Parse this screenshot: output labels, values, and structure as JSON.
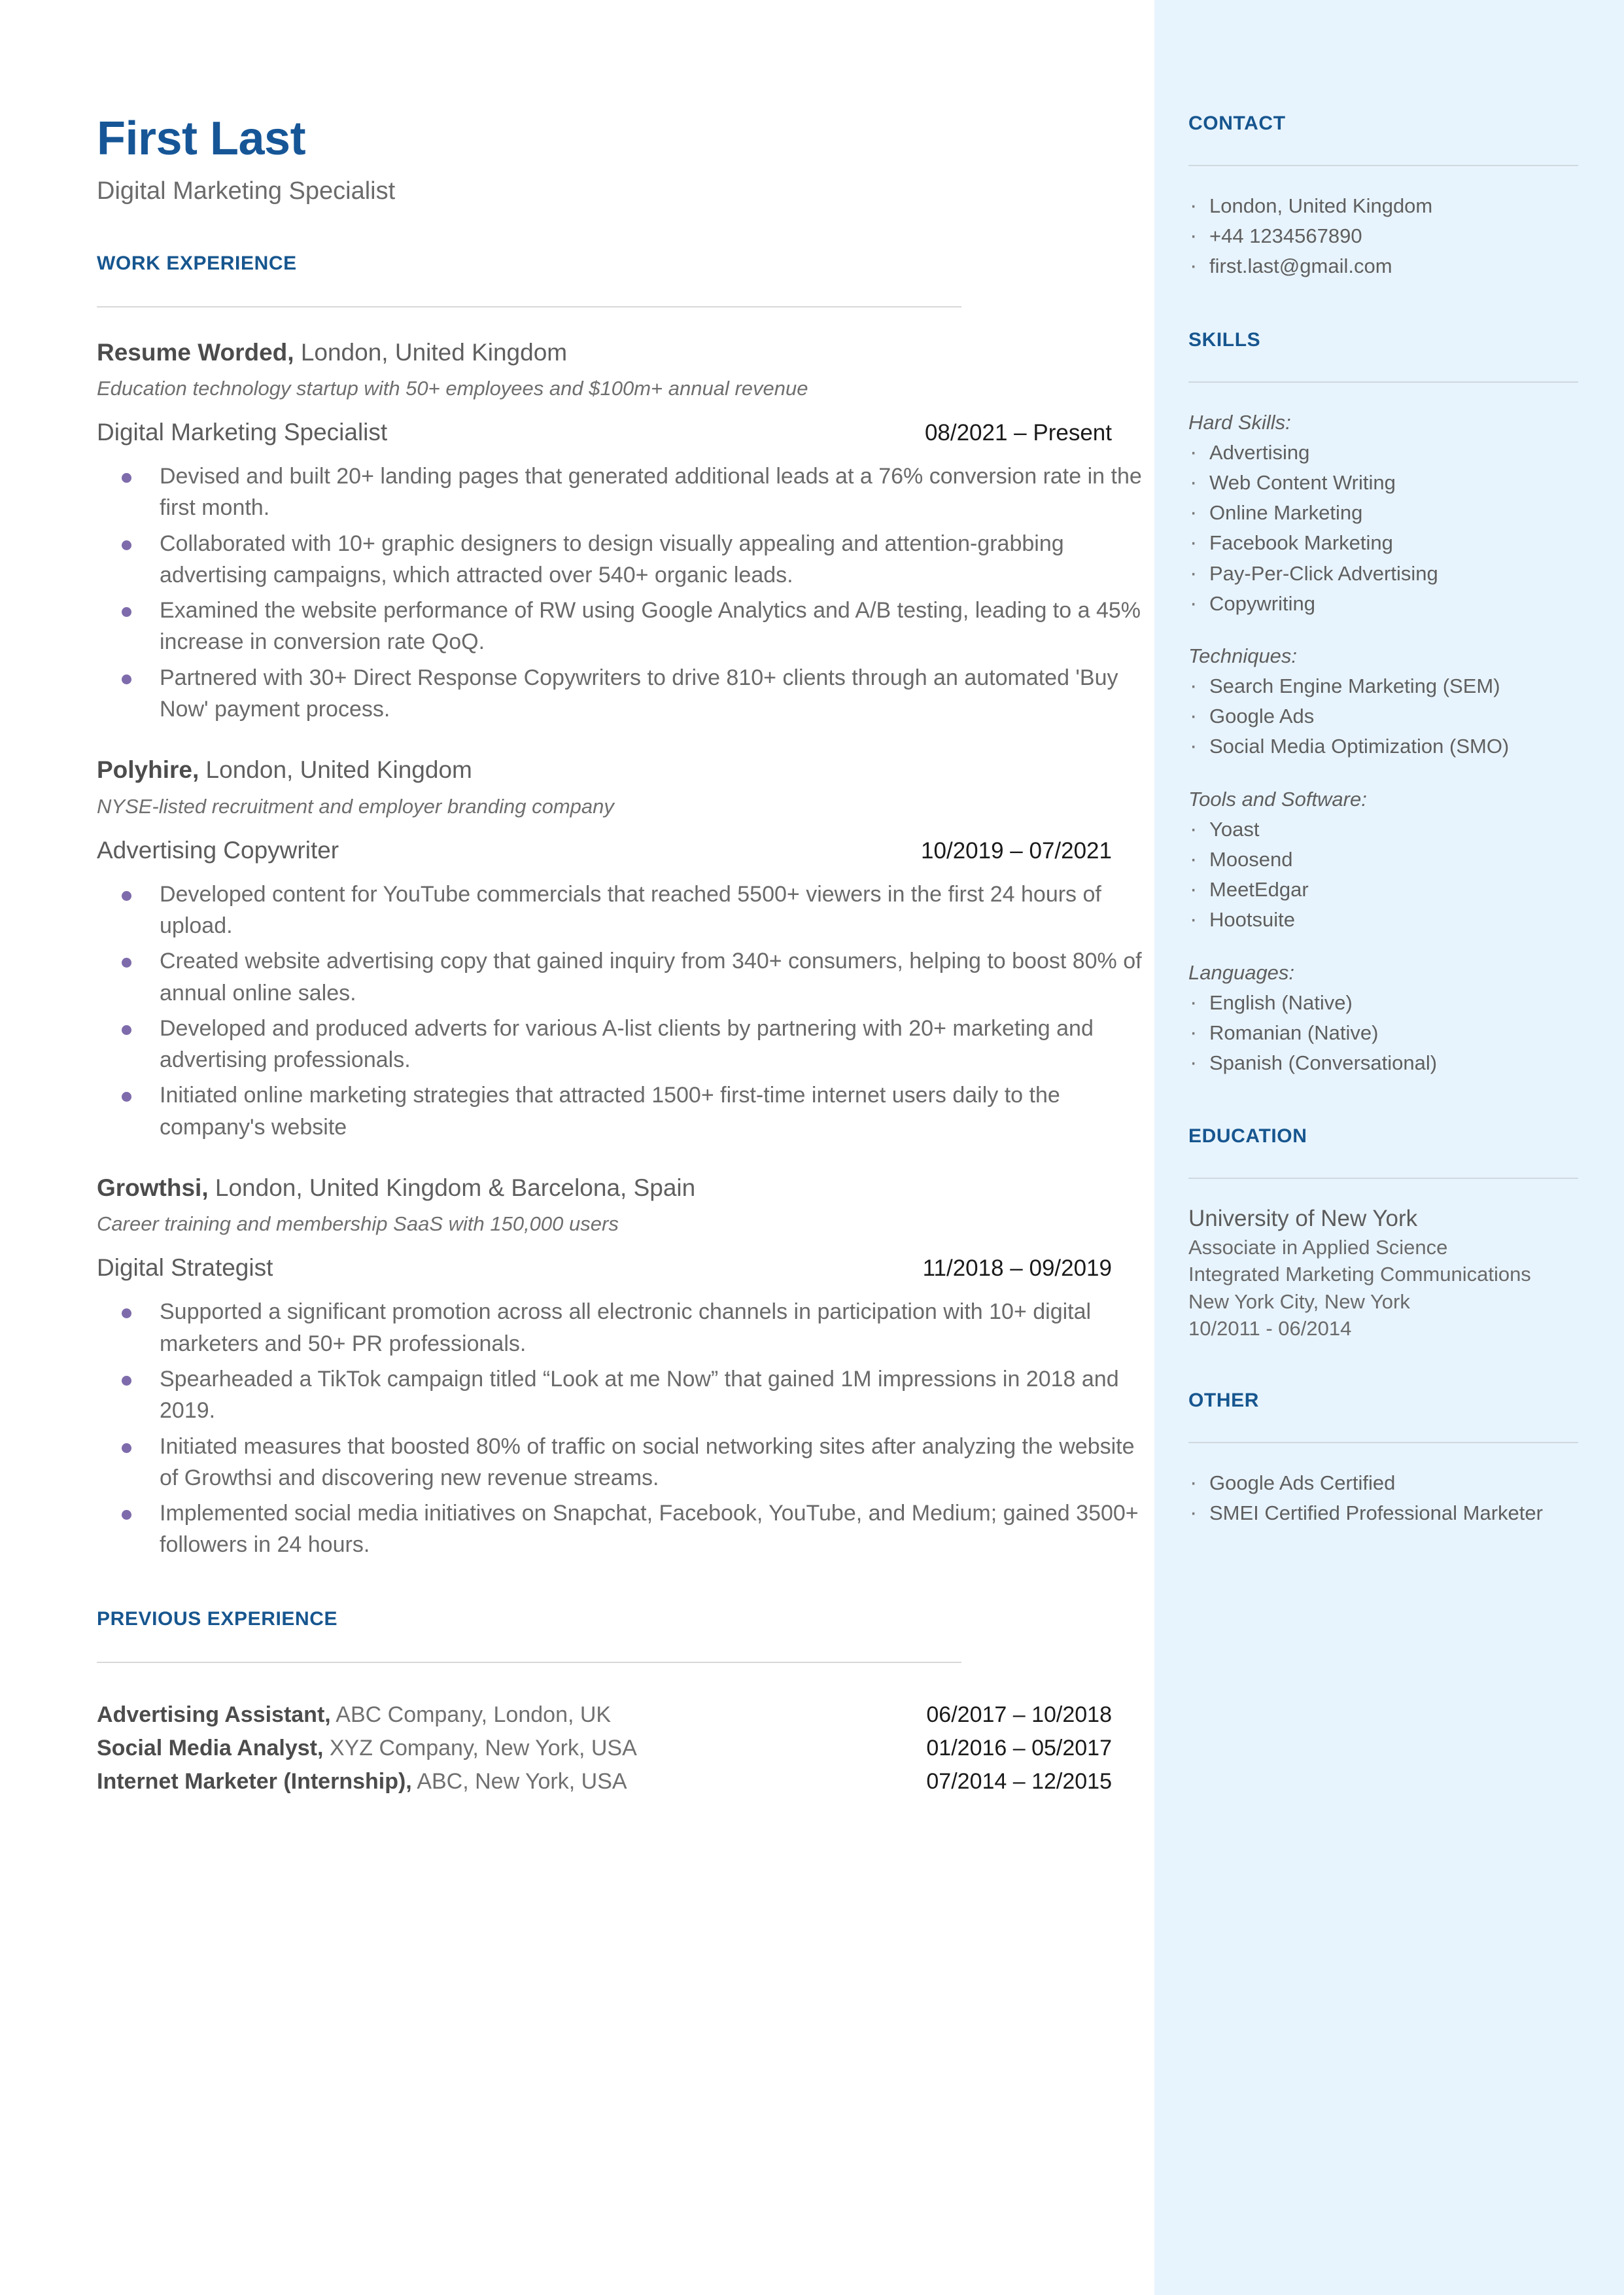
{
  "colors": {
    "accent_blue": "#17568f",
    "name_blue": "#165697",
    "sidebar_bg": "#e8f4fd",
    "bullet_purple": "#7e6bab",
    "body_text": "#6a6a6a"
  },
  "header": {
    "name": "First Last",
    "headline": "Digital Marketing Specialist"
  },
  "work_experience": {
    "section_title": "WORK EXPERIENCE",
    "jobs": [
      {
        "company": "Resume Worded,",
        "location": " London, United Kingdom",
        "description": "Education technology startup with 50+ employees and $100m+ annual revenue",
        "title": "Digital Marketing Specialist",
        "dates": "08/2021 – Present",
        "bullets": [
          "Devised and built 20+ landing pages that generated additional leads at a 76% conversion rate in the first month.",
          "Collaborated with 10+ graphic designers to design visually appealing and attention-grabbing advertising campaigns, which attracted over 540+ organic leads.",
          "Examined the website performance of RW using Google Analytics and A/B testing, leading to a 45% increase in conversion rate QoQ.",
          "Partnered with 30+ Direct Response Copywriters to drive 810+ clients through an automated 'Buy Now' payment process."
        ]
      },
      {
        "company": "Polyhire,",
        "location": " London, United Kingdom",
        "description": "NYSE-listed recruitment and employer branding company",
        "title": "Advertising Copywriter",
        "dates": "10/2019 – 07/2021",
        "bullets": [
          "Developed content for YouTube commercials that reached 5500+ viewers in the first 24 hours of upload.",
          "Created website advertising copy that gained inquiry from 340+ consumers, helping to boost 80% of annual online sales.",
          "Developed and produced adverts for various A-list clients by partnering with 20+ marketing and advertising professionals.",
          "Initiated online marketing strategies that attracted 1500+ first-time internet users daily to the company's website"
        ]
      },
      {
        "company": "Growthsi,",
        "location": " London, United Kingdom & Barcelona, Spain",
        "description": "Career training and membership SaaS with 150,000 users",
        "title": "Digital Strategist",
        "dates": "11/2018 – 09/2019",
        "bullets": [
          "Supported a significant promotion across all electronic channels in participation with 10+ digital marketers and 50+ PR professionals.",
          "Spearheaded a TikTok campaign titled “Look at me Now” that gained 1M impressions in 2018 and 2019.",
          "Initiated measures that boosted 80% of traffic on social networking sites after analyzing the website of Growthsi and discovering new revenue streams.",
          "Implemented social media initiatives on Snapchat, Facebook, YouTube, and Medium; gained 3500+ followers in 24 hours."
        ]
      }
    ]
  },
  "previous_experience": {
    "section_title": "PREVIOUS EXPERIENCE",
    "rows": [
      {
        "role": "Advertising Assistant,",
        "detail": " ABC Company, London, UK",
        "dates": "06/2017 – 10/2018"
      },
      {
        "role": "Social Media Analyst,",
        "detail": " XYZ Company, New York, USA",
        "dates": "01/2016 – 05/2017"
      },
      {
        "role": "Internet Marketer (Internship),",
        "detail": " ABC, New York, USA",
        "dates": "07/2014 – 12/2015"
      }
    ]
  },
  "sidebar": {
    "contact": {
      "section_title": "CONTACT",
      "items": [
        "London, United Kingdom",
        "+44 1234567890",
        "first.last@gmail.com"
      ]
    },
    "skills": {
      "section_title": "SKILLS",
      "groups": [
        {
          "label": "Hard Skills:",
          "items": [
            "Advertising",
            "Web Content Writing",
            "Online Marketing",
            "Facebook Marketing",
            "Pay-Per-Click Advertising",
            "Copywriting"
          ]
        },
        {
          "label": "Techniques:",
          "items": [
            "Search Engine Marketing (SEM)",
            "Google Ads",
            "Social Media Optimization (SMO)"
          ]
        },
        {
          "label": "Tools and Software:",
          "items": [
            "Yoast",
            "Moosend",
            "MeetEdgar",
            "Hootsuite"
          ]
        },
        {
          "label": "Languages:",
          "items": [
            "English (Native)",
            "Romanian (Native)",
            "Spanish (Conversational)"
          ]
        }
      ]
    },
    "education": {
      "section_title": "EDUCATION",
      "school": "University of New York",
      "degree": "Associate in Applied Science",
      "field": "Integrated Marketing Communications",
      "location": "New York City, New York",
      "dates": "10/2011 - 06/2014"
    },
    "other": {
      "section_title": "OTHER",
      "items": [
        "Google Ads Certified",
        "SMEI Certified Professional Marketer"
      ]
    }
  }
}
